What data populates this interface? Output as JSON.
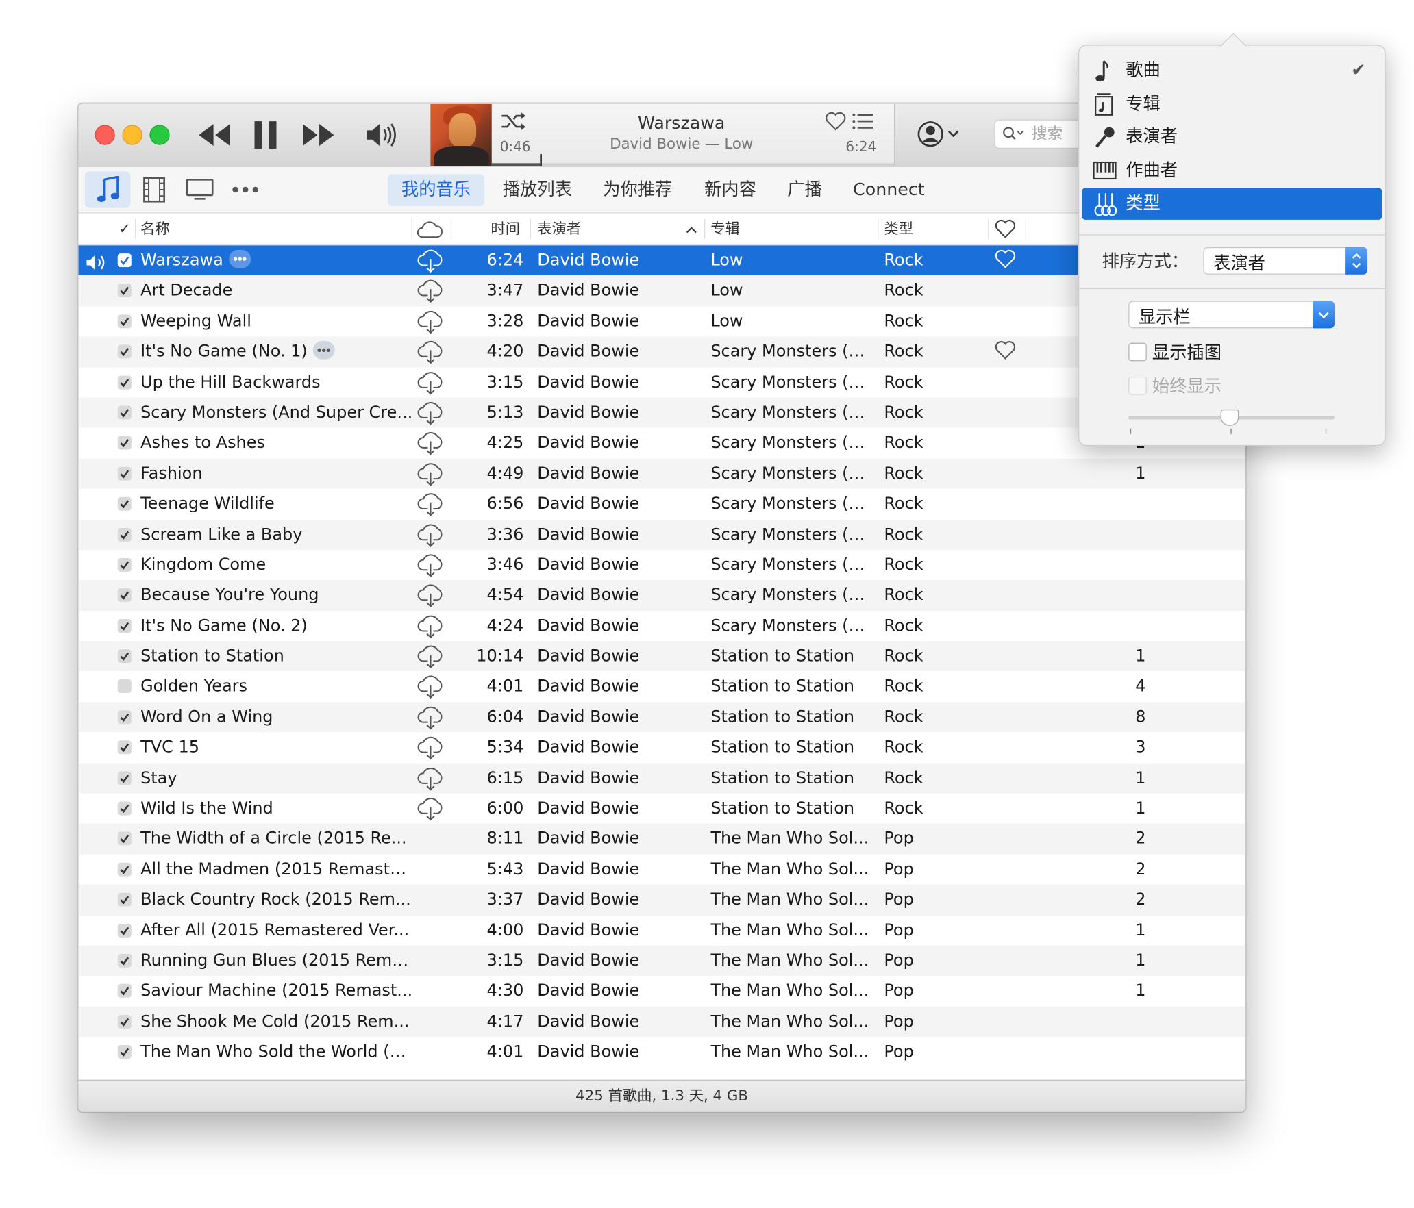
{
  "window": {
    "lcd": {
      "title": "Warszawa",
      "subtitle": "David Bowie — Low",
      "elapsed": "0:46",
      "total": "6:24",
      "progress": 0.12
    },
    "search_placeholder": "搜索"
  },
  "nav": {
    "media_icons": [
      "music-note-icon",
      "film-icon",
      "tv-icon",
      "more-icon"
    ],
    "tabs": [
      {
        "label": "我的音乐",
        "selected": true
      },
      {
        "label": "播放列表",
        "selected": false
      },
      {
        "label": "为你推荐",
        "selected": false
      },
      {
        "label": "新内容",
        "selected": false
      },
      {
        "label": "广播",
        "selected": false
      },
      {
        "label": "Connect",
        "selected": false
      }
    ]
  },
  "table": {
    "headers": {
      "check": "✓",
      "name": "名称",
      "time": "时间",
      "artist": "表演者",
      "album": "专辑",
      "genre": "类型"
    },
    "rows": [
      {
        "checked": true,
        "name": "Warszawa",
        "time": "6:24",
        "artist": "David Bowie",
        "album": "Low",
        "genre": "Rock",
        "plays": "",
        "more": true,
        "loved": true,
        "cloud": true,
        "playing": true
      },
      {
        "checked": true,
        "name": "Art Decade",
        "time": "3:47",
        "artist": "David Bowie",
        "album": "Low",
        "genre": "Rock",
        "plays": "",
        "cloud": true
      },
      {
        "checked": true,
        "name": "Weeping Wall",
        "time": "3:28",
        "artist": "David Bowie",
        "album": "Low",
        "genre": "Rock",
        "plays": "",
        "cloud": true
      },
      {
        "checked": true,
        "name": "It's No Game (No. 1)",
        "time": "4:20",
        "artist": "David Bowie",
        "album": "Scary Monsters (A...",
        "genre": "Rock",
        "plays": "",
        "more": true,
        "loved": true,
        "cloud": true
      },
      {
        "checked": true,
        "name": "Up the Hill Backwards",
        "time": "3:15",
        "artist": "David Bowie",
        "album": "Scary Monsters (A...",
        "genre": "Rock",
        "plays": "",
        "cloud": true
      },
      {
        "checked": true,
        "name": "Scary Monsters (And Super Cre...",
        "time": "5:13",
        "artist": "David Bowie",
        "album": "Scary Monsters (A...",
        "genre": "Rock",
        "plays": "",
        "cloud": true
      },
      {
        "checked": true,
        "name": "Ashes to Ashes",
        "time": "4:25",
        "artist": "David Bowie",
        "album": "Scary Monsters (A...",
        "genre": "Rock",
        "plays": "2",
        "cloud": true
      },
      {
        "checked": true,
        "name": "Fashion",
        "time": "4:49",
        "artist": "David Bowie",
        "album": "Scary Monsters (A...",
        "genre": "Rock",
        "plays": "1",
        "cloud": true
      },
      {
        "checked": true,
        "name": "Teenage Wildlife",
        "time": "6:56",
        "artist": "David Bowie",
        "album": "Scary Monsters (A...",
        "genre": "Rock",
        "plays": "",
        "cloud": true
      },
      {
        "checked": true,
        "name": "Scream Like a Baby",
        "time": "3:36",
        "artist": "David Bowie",
        "album": "Scary Monsters (A...",
        "genre": "Rock",
        "plays": "",
        "cloud": true
      },
      {
        "checked": true,
        "name": "Kingdom Come",
        "time": "3:46",
        "artist": "David Bowie",
        "album": "Scary Monsters (A...",
        "genre": "Rock",
        "plays": "",
        "cloud": true
      },
      {
        "checked": true,
        "name": "Because You're Young",
        "time": "4:54",
        "artist": "David Bowie",
        "album": "Scary Monsters (A...",
        "genre": "Rock",
        "plays": "",
        "cloud": true
      },
      {
        "checked": true,
        "name": "It's No Game (No. 2)",
        "time": "4:24",
        "artist": "David Bowie",
        "album": "Scary Monsters (A...",
        "genre": "Rock",
        "plays": "",
        "cloud": true
      },
      {
        "checked": true,
        "name": "Station to Station",
        "time": "10:14",
        "artist": "David Bowie",
        "album": "Station to Station",
        "genre": "Rock",
        "plays": "1",
        "cloud": true
      },
      {
        "checked": false,
        "name": "Golden Years",
        "time": "4:01",
        "artist": "David Bowie",
        "album": "Station to Station",
        "genre": "Rock",
        "plays": "4",
        "cloud": true
      },
      {
        "checked": true,
        "name": "Word On a Wing",
        "time": "6:04",
        "artist": "David Bowie",
        "album": "Station to Station",
        "genre": "Rock",
        "plays": "8",
        "cloud": true
      },
      {
        "checked": true,
        "name": "TVC 15",
        "time": "5:34",
        "artist": "David Bowie",
        "album": "Station to Station",
        "genre": "Rock",
        "plays": "3",
        "cloud": true
      },
      {
        "checked": true,
        "name": "Stay",
        "time": "6:15",
        "artist": "David Bowie",
        "album": "Station to Station",
        "genre": "Rock",
        "plays": "1",
        "cloud": true
      },
      {
        "checked": true,
        "name": "Wild Is the Wind",
        "time": "6:00",
        "artist": "David Bowie",
        "album": "Station to Station",
        "genre": "Rock",
        "plays": "1",
        "cloud": true
      },
      {
        "checked": true,
        "name": "The Width of a Circle (2015 Re...",
        "time": "8:11",
        "artist": "David Bowie",
        "album": "The Man Who Sol...",
        "genre": "Pop",
        "plays": "2"
      },
      {
        "checked": true,
        "name": "All the Madmen (2015 Remaste...",
        "time": "5:43",
        "artist": "David Bowie",
        "album": "The Man Who Sol...",
        "genre": "Pop",
        "plays": "2"
      },
      {
        "checked": true,
        "name": "Black Country Rock (2015 Rem...",
        "time": "3:37",
        "artist": "David Bowie",
        "album": "The Man Who Sol...",
        "genre": "Pop",
        "plays": "2"
      },
      {
        "checked": true,
        "name": "After All (2015 Remastered Ver...",
        "time": "4:00",
        "artist": "David Bowie",
        "album": "The Man Who Sol...",
        "genre": "Pop",
        "plays": "1"
      },
      {
        "checked": true,
        "name": "Running Gun Blues (2015 Rema...",
        "time": "3:15",
        "artist": "David Bowie",
        "album": "The Man Who Sol...",
        "genre": "Pop",
        "plays": "1"
      },
      {
        "checked": true,
        "name": "Saviour Machine (2015 Remast...",
        "time": "4:30",
        "artist": "David Bowie",
        "album": "The Man Who Sol...",
        "genre": "Pop",
        "plays": "1"
      },
      {
        "checked": true,
        "name": "She Shook Me Cold (2015 Rem...",
        "time": "4:17",
        "artist": "David Bowie",
        "album": "The Man Who Sol...",
        "genre": "Pop",
        "plays": ""
      },
      {
        "checked": true,
        "name": "The Man Who Sold the World (2...",
        "time": "4:01",
        "artist": "David Bowie",
        "album": "The Man Who Sol...",
        "genre": "Pop",
        "plays": ""
      }
    ]
  },
  "status": "425 首歌曲, 1.3 天, 4 GB",
  "popover": {
    "items": [
      {
        "label": "歌曲",
        "icon": "music-note-icon",
        "checked": true,
        "selected": false
      },
      {
        "label": "专辑",
        "icon": "album-icon",
        "checked": false,
        "selected": false
      },
      {
        "label": "表演者",
        "icon": "microphone-icon",
        "checked": false,
        "selected": false
      },
      {
        "label": "作曲者",
        "icon": "piano-icon",
        "checked": false,
        "selected": false
      },
      {
        "label": "类型",
        "icon": "guitars-icon",
        "checked": false,
        "selected": true
      }
    ],
    "sort_label": "排序方式：",
    "sort_value": "表演者",
    "columns_label": "显示栏",
    "show_artwork_label": "显示插图",
    "always_show_label": "始终显示",
    "checkmark": "✔",
    "colors": {
      "accent": "#1a6fd9"
    }
  }
}
